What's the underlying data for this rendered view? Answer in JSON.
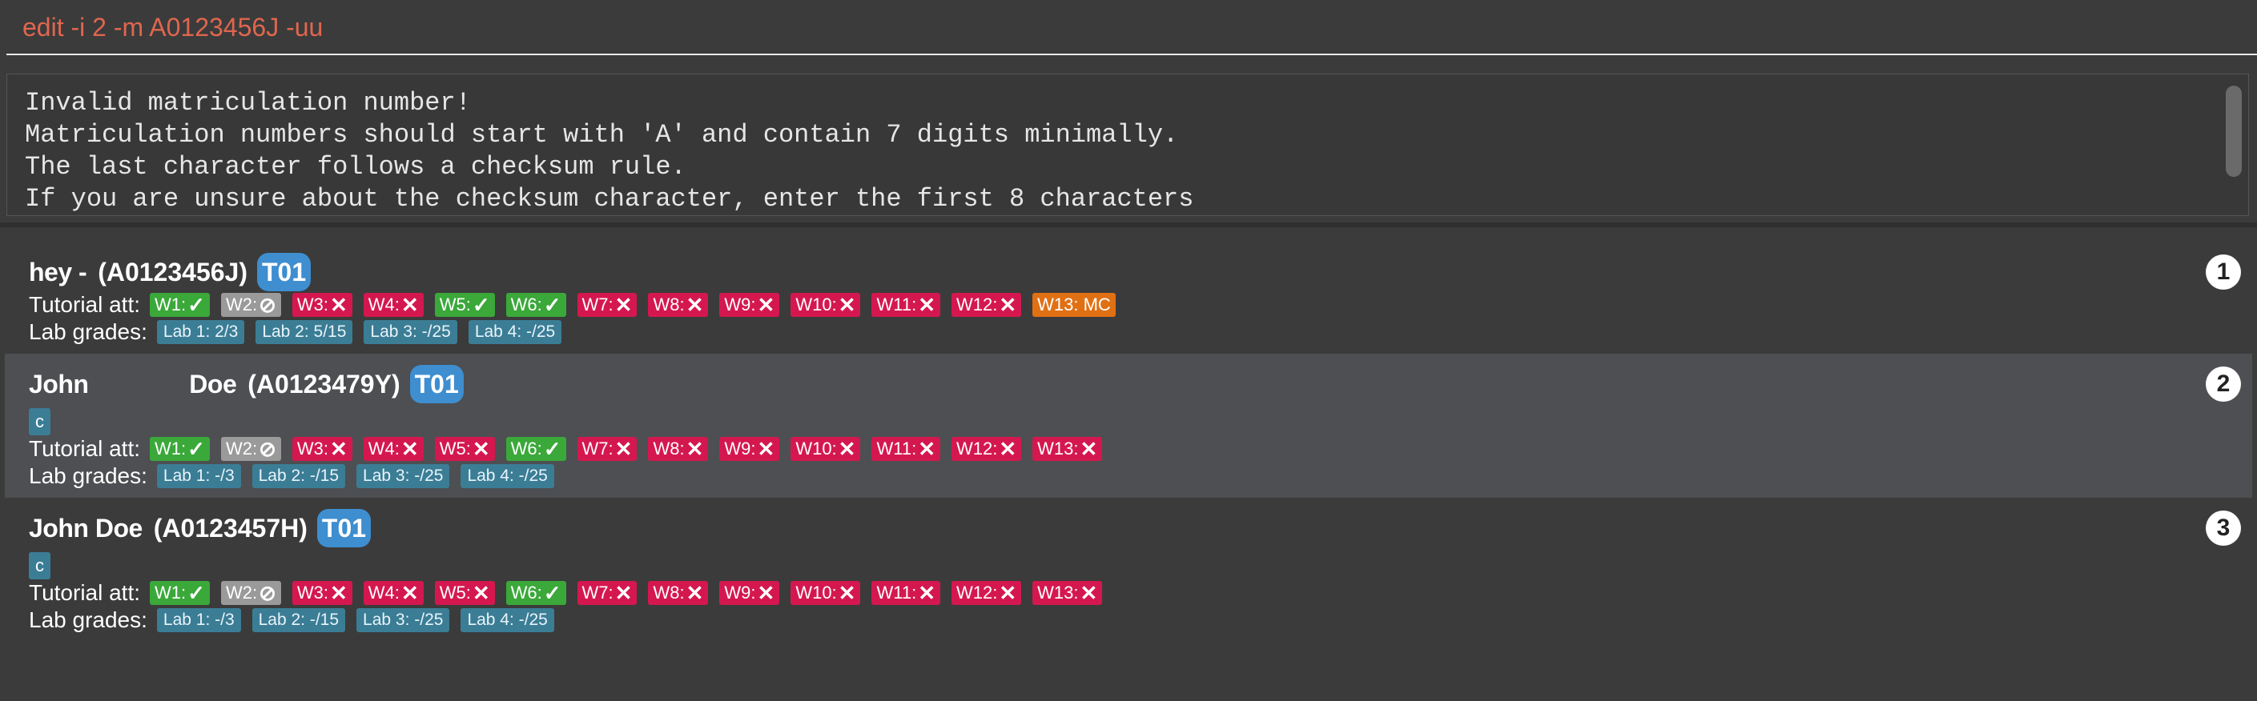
{
  "command": {
    "text": "edit -i 2 -m A0123456J -uu"
  },
  "result": {
    "lines": [
      "Invalid matriculation number!",
      "Matriculation numbers should start with 'A' and contain 7 digits minimally.",
      "The last character follows a checksum rule.",
      "If you are unsure about the checksum character, enter the first 8 characters"
    ]
  },
  "labels": {
    "tutorial": "Tutorial att:",
    "lab": "Lab grades:"
  },
  "students": [
    {
      "index": "1",
      "name": "hey -",
      "matric": "(A0123456J)",
      "tutorial": "T01",
      "tag": "",
      "attendance": [
        {
          "label": "W1:",
          "mark": "✓",
          "status": "present"
        },
        {
          "label": "W2:",
          "mark": "⊘",
          "status": "na"
        },
        {
          "label": "W3:",
          "mark": "✕",
          "status": "absent"
        },
        {
          "label": "W4:",
          "mark": "✕",
          "status": "absent"
        },
        {
          "label": "W5:",
          "mark": "✓",
          "status": "present"
        },
        {
          "label": "W6:",
          "mark": "✓",
          "status": "present"
        },
        {
          "label": "W7:",
          "mark": "✕",
          "status": "absent"
        },
        {
          "label": "W8:",
          "mark": "✕",
          "status": "absent"
        },
        {
          "label": "W9:",
          "mark": "✕",
          "status": "absent"
        },
        {
          "label": "W10:",
          "mark": "✕",
          "status": "absent"
        },
        {
          "label": "W11:",
          "mark": "✕",
          "status": "absent"
        },
        {
          "label": "W12:",
          "mark": "✕",
          "status": "absent"
        },
        {
          "label": "W13: MC",
          "mark": "",
          "status": "mc"
        }
      ],
      "labs": [
        "Lab 1: 2/3",
        "Lab 2: 5/15",
        "Lab 3: -/25",
        "Lab 4: -/25"
      ]
    },
    {
      "index": "2",
      "name": "John               Doe",
      "matric": "(A0123479Y)",
      "tutorial": "T01",
      "tag": "c",
      "attendance": [
        {
          "label": "W1:",
          "mark": "✓",
          "status": "present"
        },
        {
          "label": "W2:",
          "mark": "⊘",
          "status": "na"
        },
        {
          "label": "W3:",
          "mark": "✕",
          "status": "absent"
        },
        {
          "label": "W4:",
          "mark": "✕",
          "status": "absent"
        },
        {
          "label": "W5:",
          "mark": "✕",
          "status": "absent"
        },
        {
          "label": "W6:",
          "mark": "✓",
          "status": "present"
        },
        {
          "label": "W7:",
          "mark": "✕",
          "status": "absent"
        },
        {
          "label": "W8:",
          "mark": "✕",
          "status": "absent"
        },
        {
          "label": "W9:",
          "mark": "✕",
          "status": "absent"
        },
        {
          "label": "W10:",
          "mark": "✕",
          "status": "absent"
        },
        {
          "label": "W11:",
          "mark": "✕",
          "status": "absent"
        },
        {
          "label": "W12:",
          "mark": "✕",
          "status": "absent"
        },
        {
          "label": "W13:",
          "mark": "✕",
          "status": "absent"
        }
      ],
      "labs": [
        "Lab 1: -/3",
        "Lab 2: -/15",
        "Lab 3: -/25",
        "Lab 4: -/25"
      ]
    },
    {
      "index": "3",
      "name": "John Doe",
      "matric": "(A0123457H)",
      "tutorial": "T01",
      "tag": "c",
      "attendance": [
        {
          "label": "W1:",
          "mark": "✓",
          "status": "present"
        },
        {
          "label": "W2:",
          "mark": "⊘",
          "status": "na"
        },
        {
          "label": "W3:",
          "mark": "✕",
          "status": "absent"
        },
        {
          "label": "W4:",
          "mark": "✕",
          "status": "absent"
        },
        {
          "label": "W5:",
          "mark": "✕",
          "status": "absent"
        },
        {
          "label": "W6:",
          "mark": "✓",
          "status": "present"
        },
        {
          "label": "W7:",
          "mark": "✕",
          "status": "absent"
        },
        {
          "label": "W8:",
          "mark": "✕",
          "status": "absent"
        },
        {
          "label": "W9:",
          "mark": "✕",
          "status": "absent"
        },
        {
          "label": "W10:",
          "mark": "✕",
          "status": "absent"
        },
        {
          "label": "W11:",
          "mark": "✕",
          "status": "absent"
        },
        {
          "label": "W12:",
          "mark": "✕",
          "status": "absent"
        },
        {
          "label": "W13:",
          "mark": "✕",
          "status": "absent"
        }
      ],
      "labs": [
        "Lab 1: -/3",
        "Lab 2: -/15",
        "Lab 3: -/25",
        "Lab 4: -/25"
      ]
    }
  ],
  "colors": {
    "command_text": "#e0664e",
    "present": "#3ba83a",
    "absent": "#d4184f",
    "not_applicable": "#9a9a9a",
    "mc": "#e07014",
    "tutorial_tag": "#3e8ed0",
    "lab_tag": "#3b7d95"
  }
}
